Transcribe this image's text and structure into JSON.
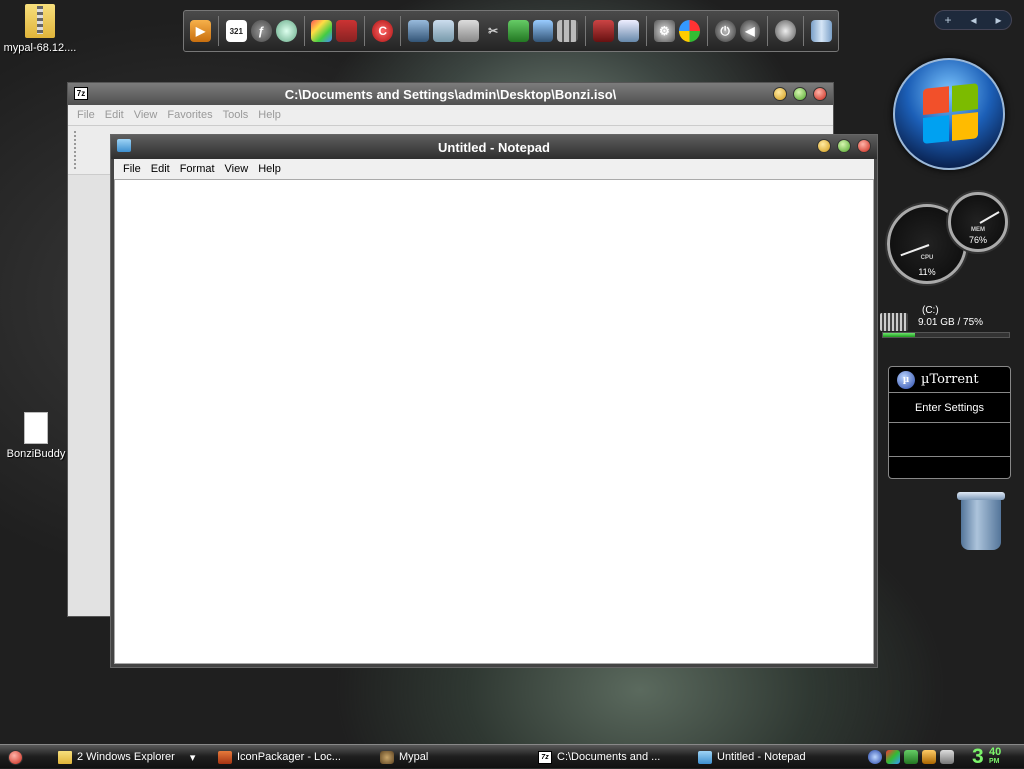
{
  "desktop": {
    "icons": [
      {
        "label": "mypal-68.12...."
      },
      {
        "label": "BonziBuddy"
      }
    ]
  },
  "dock": {
    "icons": [
      "media-player-icon",
      "calendar-321-icon",
      "flash-icon",
      "disc-icon",
      "paint-icon",
      "books-icon",
      "ccleaner-icon",
      "network-icon",
      "document-icon",
      "calculator-icon",
      "scissors-icon",
      "green-book-icon",
      "monitor-icon",
      "grid-icon",
      "usb-icon",
      "window-icon",
      "settings-icon",
      "windows-logo-icon",
      "power-icon",
      "volume-icon",
      "raccoon-icon",
      "recycle-bin-icon"
    ],
    "dock_321": "321"
  },
  "desk_control": {
    "plus": "+",
    "prev": "◂",
    "next": "▸"
  },
  "explorer": {
    "title": "C:\\Documents and Settings\\admin\\Desktop\\Bonzi.iso\\",
    "icon": "7z",
    "menu": [
      "File",
      "Edit",
      "View",
      "Favorites",
      "Tools",
      "Help"
    ]
  },
  "notepad": {
    "title": "Untitled - Notepad",
    "menu": [
      "File",
      "Edit",
      "Format",
      "View",
      "Help"
    ],
    "content": ""
  },
  "gadgets": {
    "cpu": {
      "label": "CPU",
      "value": "11%"
    },
    "mem": {
      "label": "MEM",
      "value": "76%"
    },
    "drive": {
      "name": "(C:)",
      "usage": "9.01 GB / 75%",
      "fill_percent": 0.25
    },
    "utorrent": {
      "title": "µTorrent",
      "logo": "µ",
      "action": "Enter Settings"
    }
  },
  "taskbar": {
    "tasks": [
      {
        "label": "2 Windows Explorer",
        "icon": "folder"
      },
      {
        "label": "IconPackager - Loc...",
        "icon": "package"
      },
      {
        "label": "Mypal",
        "icon": "mypal"
      },
      {
        "label": "C:\\Documents and ...",
        "icon": "7z",
        "icon_text": "7z"
      },
      {
        "label": "Untitled - Notepad",
        "icon": "notepad"
      }
    ],
    "dropdown": "▾",
    "clock": {
      "hour": "3",
      "minute": "40",
      "ampm": "PM"
    }
  }
}
